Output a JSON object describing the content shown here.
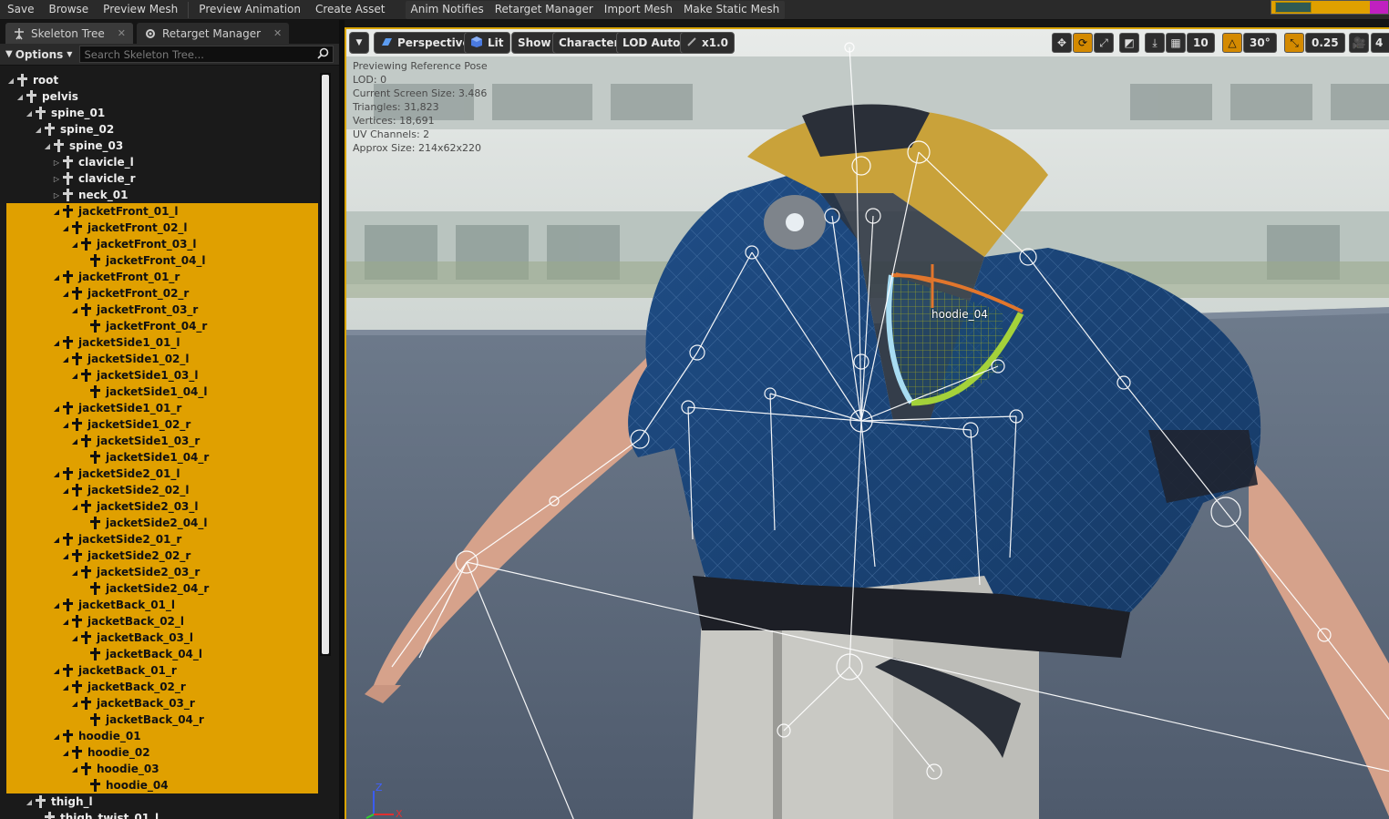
{
  "toolbar": {
    "items": [
      "Save",
      "Browse",
      "Preview Mesh",
      "Preview Animation",
      "Create Asset"
    ],
    "items2": [
      "Anim Notifies",
      "Retarget Manager",
      "Import Mesh",
      "Make Static Mesh"
    ]
  },
  "left_panel": {
    "tabs": [
      {
        "label": "Skeleton Tree",
        "active": true
      },
      {
        "label": "Retarget Manager",
        "active": false
      }
    ],
    "options_label": "Options",
    "search_placeholder": "Search Skeleton Tree...",
    "tree": [
      {
        "label": "root",
        "depth": 0,
        "expanded": true,
        "selected": false
      },
      {
        "label": "pelvis",
        "depth": 1,
        "expanded": true,
        "selected": false
      },
      {
        "label": "spine_01",
        "depth": 2,
        "expanded": true,
        "selected": false
      },
      {
        "label": "spine_02",
        "depth": 3,
        "expanded": true,
        "selected": false
      },
      {
        "label": "spine_03",
        "depth": 4,
        "expanded": true,
        "selected": false
      },
      {
        "label": "clavicle_l",
        "depth": 5,
        "expanded": false,
        "selected": false
      },
      {
        "label": "clavicle_r",
        "depth": 5,
        "expanded": false,
        "selected": false
      },
      {
        "label": "neck_01",
        "depth": 5,
        "expanded": false,
        "selected": false
      },
      {
        "label": "jacketFront_01_l",
        "depth": 5,
        "expanded": true,
        "selected": true
      },
      {
        "label": "jacketFront_02_l",
        "depth": 6,
        "expanded": true,
        "selected": true
      },
      {
        "label": "jacketFront_03_l",
        "depth": 7,
        "expanded": true,
        "selected": true
      },
      {
        "label": "jacketFront_04_l",
        "depth": 8,
        "expanded": null,
        "selected": true
      },
      {
        "label": "jacketFront_01_r",
        "depth": 5,
        "expanded": true,
        "selected": true
      },
      {
        "label": "jacketFront_02_r",
        "depth": 6,
        "expanded": true,
        "selected": true
      },
      {
        "label": "jacketFront_03_r",
        "depth": 7,
        "expanded": true,
        "selected": true
      },
      {
        "label": "jacketFront_04_r",
        "depth": 8,
        "expanded": null,
        "selected": true
      },
      {
        "label": "jacketSide1_01_l",
        "depth": 5,
        "expanded": true,
        "selected": true
      },
      {
        "label": "jacketSide1_02_l",
        "depth": 6,
        "expanded": true,
        "selected": true
      },
      {
        "label": "jacketSide1_03_l",
        "depth": 7,
        "expanded": true,
        "selected": true
      },
      {
        "label": "jacketSide1_04_l",
        "depth": 8,
        "expanded": null,
        "selected": true
      },
      {
        "label": "jacketSide1_01_r",
        "depth": 5,
        "expanded": true,
        "selected": true
      },
      {
        "label": "jacketSide1_02_r",
        "depth": 6,
        "expanded": true,
        "selected": true
      },
      {
        "label": "jacketSide1_03_r",
        "depth": 7,
        "expanded": true,
        "selected": true
      },
      {
        "label": "jacketSide1_04_r",
        "depth": 8,
        "expanded": null,
        "selected": true
      },
      {
        "label": "jacketSide2_01_l",
        "depth": 5,
        "expanded": true,
        "selected": true
      },
      {
        "label": "jacketSide2_02_l",
        "depth": 6,
        "expanded": true,
        "selected": true
      },
      {
        "label": "jacketSide2_03_l",
        "depth": 7,
        "expanded": true,
        "selected": true
      },
      {
        "label": "jacketSide2_04_l",
        "depth": 8,
        "expanded": null,
        "selected": true
      },
      {
        "label": "jacketSide2_01_r",
        "depth": 5,
        "expanded": true,
        "selected": true
      },
      {
        "label": "jacketSide2_02_r",
        "depth": 6,
        "expanded": true,
        "selected": true
      },
      {
        "label": "jacketSide2_03_r",
        "depth": 7,
        "expanded": true,
        "selected": true
      },
      {
        "label": "jacketSide2_04_r",
        "depth": 8,
        "expanded": null,
        "selected": true
      },
      {
        "label": "jacketBack_01_l",
        "depth": 5,
        "expanded": true,
        "selected": true
      },
      {
        "label": "jacketBack_02_l",
        "depth": 6,
        "expanded": true,
        "selected": true
      },
      {
        "label": "jacketBack_03_l",
        "depth": 7,
        "expanded": true,
        "selected": true
      },
      {
        "label": "jacketBack_04_l",
        "depth": 8,
        "expanded": null,
        "selected": true
      },
      {
        "label": "jacketBack_01_r",
        "depth": 5,
        "expanded": true,
        "selected": true
      },
      {
        "label": "jacketBack_02_r",
        "depth": 6,
        "expanded": true,
        "selected": true
      },
      {
        "label": "jacketBack_03_r",
        "depth": 7,
        "expanded": true,
        "selected": true
      },
      {
        "label": "jacketBack_04_r",
        "depth": 8,
        "expanded": null,
        "selected": true
      },
      {
        "label": "hoodie_01",
        "depth": 5,
        "expanded": true,
        "selected": true
      },
      {
        "label": "hoodie_02",
        "depth": 6,
        "expanded": true,
        "selected": true
      },
      {
        "label": "hoodie_03",
        "depth": 7,
        "expanded": true,
        "selected": true
      },
      {
        "label": "hoodie_04",
        "depth": 8,
        "expanded": null,
        "selected": true
      },
      {
        "label": "thigh_l",
        "depth": 2,
        "expanded": true,
        "selected": false
      },
      {
        "label": "thigh_twist_01_l",
        "depth": 3,
        "expanded": null,
        "selected": false
      }
    ]
  },
  "viewport": {
    "perspective_label": "Perspective",
    "lit_label": "Lit",
    "show_label": "Show",
    "character_label": "Character",
    "lod_label": "LOD Auto",
    "speed_label": "x1.0",
    "grid_snap_value": "10",
    "rotation_snap_value": "30°",
    "scale_snap_value": "0.25",
    "camera_speed_value": "4",
    "stats": [
      "Previewing Reference Pose",
      "LOD: 0",
      "Current Screen Size: 3.486",
      "Triangles: 31,823",
      "Vertices: 18,691",
      "UV Channels: 2",
      "Approx Size: 214x62x220"
    ],
    "selected_bone_label": "hoodie_04",
    "axis_labels": {
      "z": "Z",
      "x": "X"
    }
  },
  "colors": {
    "selection": "#e0a000",
    "jacket_blue": "#2d5a8e",
    "hood_yellow": "#c9a23a",
    "skin": "#d9a58e",
    "floor": "#5a6a7e"
  }
}
